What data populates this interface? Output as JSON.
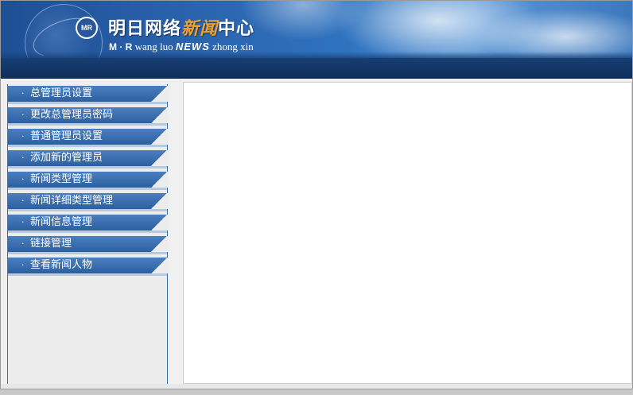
{
  "header": {
    "logo_badge": "MR",
    "title_part1": "明日网络",
    "title_accent": "新闻",
    "title_part2": "中心",
    "subtitle_mr": "M · R",
    "subtitle_text1": " wang luo ",
    "subtitle_news": "NEWS",
    "subtitle_text2": " zhong xin"
  },
  "sidebar": {
    "bullet": "·",
    "items": [
      {
        "label": "总管理员设置"
      },
      {
        "label": "更改总管理员密码"
      },
      {
        "label": "普通管理员设置"
      },
      {
        "label": "添加新的管理员"
      },
      {
        "label": "新闻类型管理"
      },
      {
        "label": "新闻详细类型管理"
      },
      {
        "label": "新闻信息管理"
      },
      {
        "label": "链接管理"
      },
      {
        "label": "查看新闻人物"
      }
    ]
  },
  "colors": {
    "banner_blue": "#2a63ad",
    "menu_blue": "#3a6eae",
    "accent_orange": "#f0a030"
  }
}
